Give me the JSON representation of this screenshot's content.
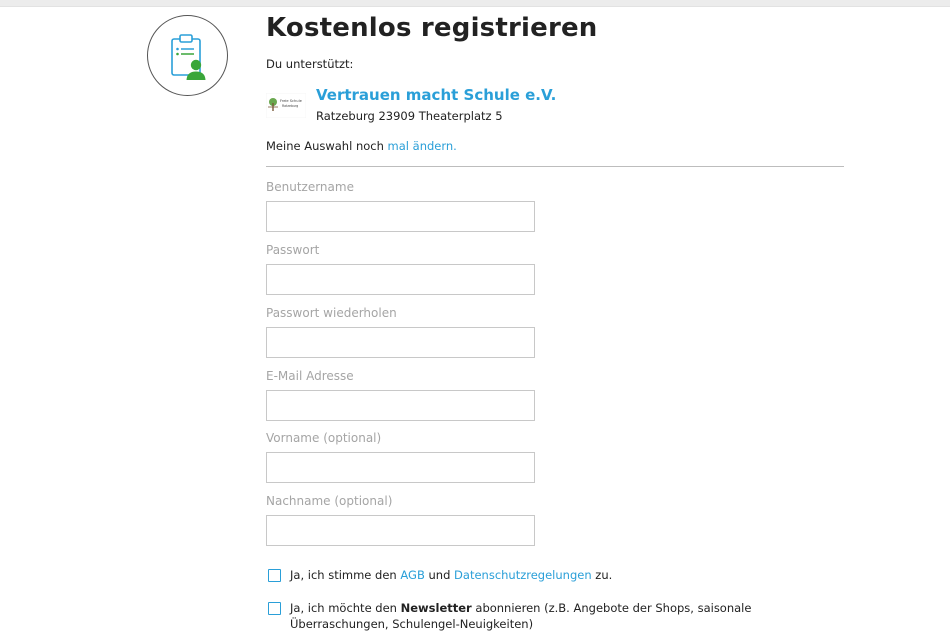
{
  "page": {
    "title": "Kostenlos registrieren",
    "support_label": "Du unterstützt:"
  },
  "school": {
    "name": "Vertrauen macht Schule e.V.",
    "address": "Ratzeburg 23909 Theaterplatz 5",
    "logo_text_line1": "Freie Schule",
    "logo_text_line2": "Ratzeburg"
  },
  "change_choice": {
    "text": "Meine Auswahl noch",
    "link": "mal ändern."
  },
  "form": {
    "fields": [
      {
        "label": "Benutzername",
        "value": ""
      },
      {
        "label": "Passwort",
        "value": ""
      },
      {
        "label": "Passwort wiederholen",
        "value": ""
      },
      {
        "label": "E-Mail Adresse",
        "value": ""
      },
      {
        "label": "Vorname (optional)",
        "value": ""
      },
      {
        "label": "Nachname (optional)",
        "value": ""
      }
    ]
  },
  "consent": {
    "agb": {
      "prefix": "Ja, ich stimme den",
      "agb_link": "AGB",
      "and": "und",
      "privacy_link": "Datenschutzregelungen",
      "suffix": "zu.",
      "checked": false
    },
    "newsletter": {
      "prefix": "Ja, ich möchte den",
      "bold": "Newsletter",
      "suffix": "abonnieren (z.B. Angebote der Shops, saisonale Überraschungen, Schulengel-Neuigkeiten)",
      "checked": false
    }
  },
  "colors": {
    "accent": "#2a9fd8",
    "icon_green": "#3aa63a",
    "label_gray": "#a5a5a5"
  },
  "icons": {
    "registration": "clipboard-user-icon"
  }
}
